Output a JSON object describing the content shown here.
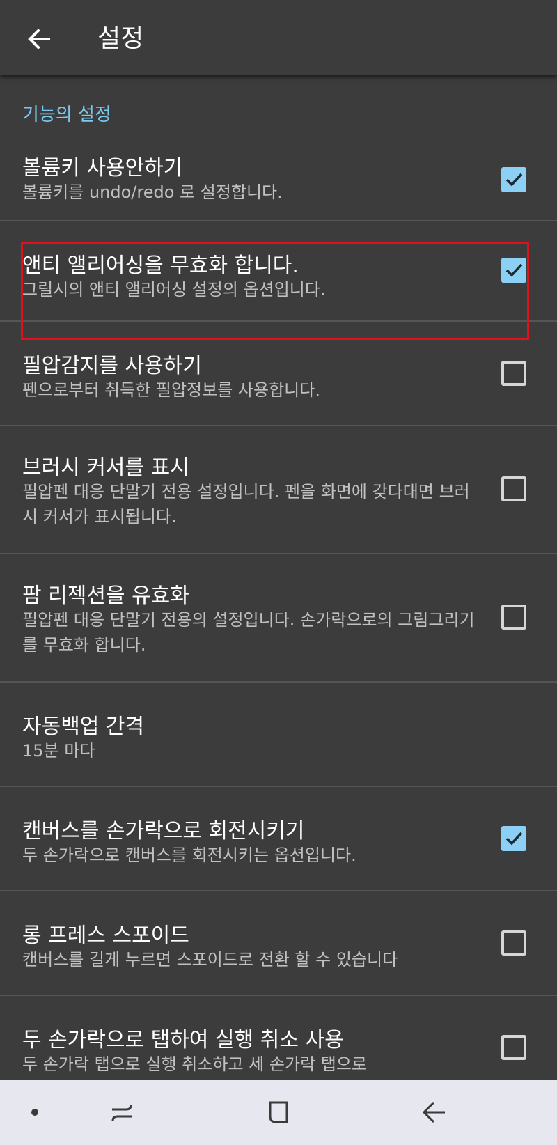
{
  "appbar": {
    "title": "설정",
    "back_icon": "arrow-left-icon"
  },
  "section": {
    "header": "기능의 설정"
  },
  "settings": [
    {
      "title": "볼륨키 사용안하기",
      "summary": "볼륨키를 undo/redo 로 설정합니다.",
      "checked": true
    },
    {
      "title": "앤티 앨리어싱을 무효화 합니다.",
      "summary": "그릴시의 앤티 앨리어싱 설정의 옵션입니다.",
      "checked": true
    },
    {
      "title": "필압감지를 사용하기",
      "summary": "펜으로부터 취득한 필압정보를 사용합니다.",
      "checked": false
    },
    {
      "title": "브러시 커서를 표시",
      "summary": "필압펜 대응 단말기 전용 설정입니다. 펜을 화면에 갖다대면 브러시 커서가 표시됩니다.",
      "checked": false
    },
    {
      "title": "팜 리젝션을 유효화",
      "summary": "필압펜 대응 단말기 전용의 설정입니다. 손가락으로의 그림그리기를 무효화 합니다.",
      "checked": false
    },
    {
      "title": "자동백업 간격",
      "summary": "15분 마다"
    },
    {
      "title": "캔버스를 손가락으로 회전시키기",
      "summary": "두 손가락으로 캔버스를 회전시키는 옵션입니다.",
      "checked": true
    },
    {
      "title": "롱 프레스 스포이드",
      "summary": "캔버스를 길게 누르면 스포이드로 전환 할 수 있습니다",
      "checked": false
    },
    {
      "title": "두 손가락으로 탭하여 실행 취소 사용",
      "summary": "두 손가락 탭으로 실행 취소하고 세 손가락 탭으로",
      "checked": false
    }
  ],
  "colors": {
    "background": "#3c3c3c",
    "accent": "#7cc8ee",
    "checkbox_on": "#8dd0f5",
    "highlight_box": "#e0111b",
    "navbar": "#e6e7ef"
  },
  "navbar": {
    "icons": [
      "dot-icon",
      "recent-apps-icon",
      "home-icon",
      "back-icon"
    ]
  }
}
